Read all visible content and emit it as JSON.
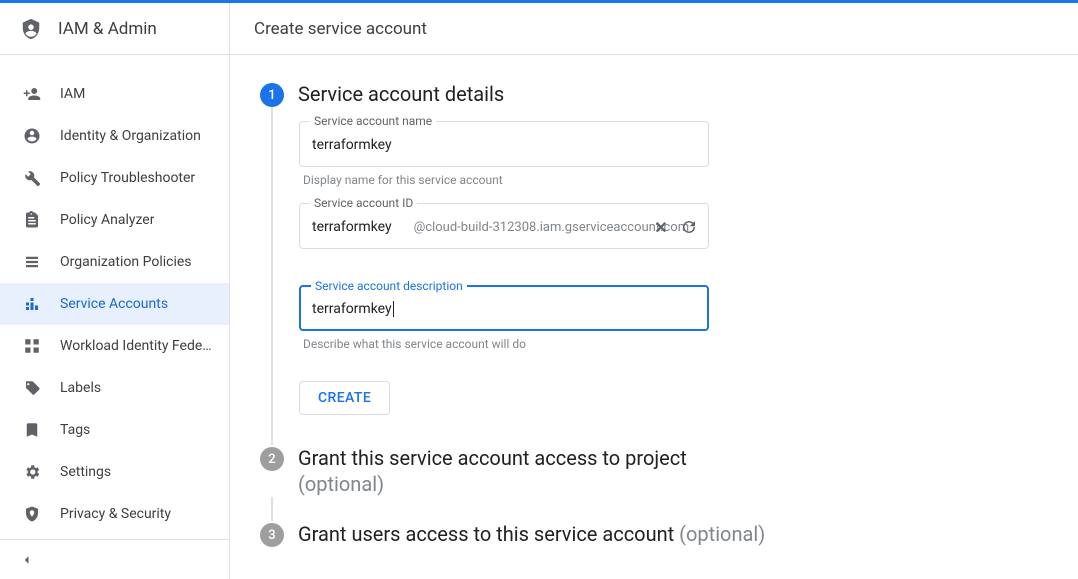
{
  "sidebar": {
    "product": "IAM & Admin",
    "items": [
      {
        "icon": "person-add",
        "label": "IAM"
      },
      {
        "icon": "account-circle",
        "label": "Identity & Organization"
      },
      {
        "icon": "wrench",
        "label": "Policy Troubleshooter"
      },
      {
        "icon": "clipboard",
        "label": "Policy Analyzer"
      },
      {
        "icon": "list",
        "label": "Organization Policies"
      },
      {
        "icon": "service-account",
        "label": "Service Accounts"
      },
      {
        "icon": "workload",
        "label": "Workload Identity Federat…"
      },
      {
        "icon": "tag",
        "label": "Labels"
      },
      {
        "icon": "bookmark",
        "label": "Tags"
      },
      {
        "icon": "gear",
        "label": "Settings"
      },
      {
        "icon": "shield-marker",
        "label": "Privacy & Security"
      }
    ],
    "active_index": 5
  },
  "page": {
    "title": "Create service account"
  },
  "steps": {
    "s1": {
      "num": "1",
      "title": "Service account details",
      "name_field": {
        "label": "Service account name",
        "value": "terraformkey",
        "helper": "Display name for this service account"
      },
      "id_field": {
        "label": "Service account ID",
        "value": "terraformkey",
        "suffix": "@cloud-build-312308.iam.gserviceaccount.com"
      },
      "desc_field": {
        "label": "Service account description",
        "value": "terraformkey",
        "helper": "Describe what this service account will do"
      },
      "create_label": "CREATE"
    },
    "s2": {
      "num": "2",
      "title": "Grant this service account access to project",
      "optional": "(optional)"
    },
    "s3": {
      "num": "3",
      "title": "Grant users access to this service account ",
      "optional": "(optional)"
    }
  }
}
